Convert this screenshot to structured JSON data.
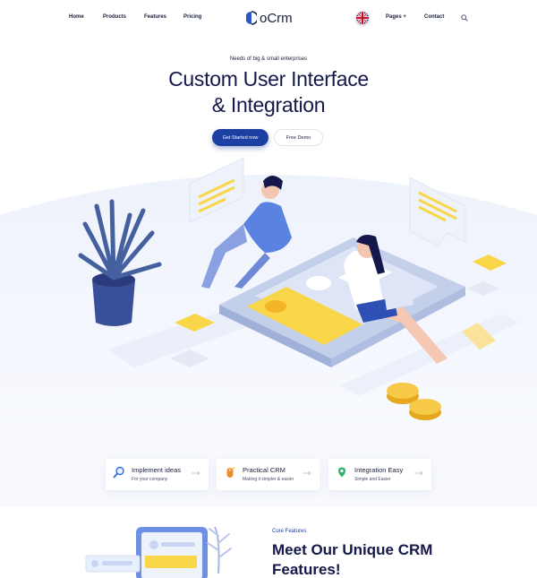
{
  "nav": {
    "links": [
      "Home",
      "Products",
      "Features",
      "Pricing"
    ],
    "logo_text": "oCrm",
    "pages_label": "Pages +",
    "contact_label": "Contact"
  },
  "hero": {
    "subtitle": "Needs of big & small enterprises",
    "title_line1": "Custom User Interface",
    "title_line2": "& Integration",
    "primary_btn": "Get Started now",
    "secondary_btn": "Free Demo"
  },
  "features": [
    {
      "title": "Implement ideas",
      "desc": "For your company",
      "icon": "magnifier-icon",
      "color": "#2f6bdb"
    },
    {
      "title": "Practical CRM",
      "desc": "Making it simpler & easier",
      "icon": "mouse-icon",
      "color": "#f08a2c"
    },
    {
      "title": "Integration Easy",
      "desc": "Simple and Easier",
      "icon": "location-pin-icon",
      "color": "#35b26a"
    }
  ],
  "core": {
    "label": "Core Features",
    "title_line1": "Meet Our Unique CRM",
    "title_line2": "Features!"
  },
  "colors": {
    "brand": "#1c3fa2",
    "heading": "#14184a",
    "accent_yellow": "#f9d548",
    "soft_blue": "#e8eefb"
  },
  "icons": [
    "uk-flag-icon",
    "search-icon",
    "logo-icon",
    "arrow-right-icon"
  ]
}
